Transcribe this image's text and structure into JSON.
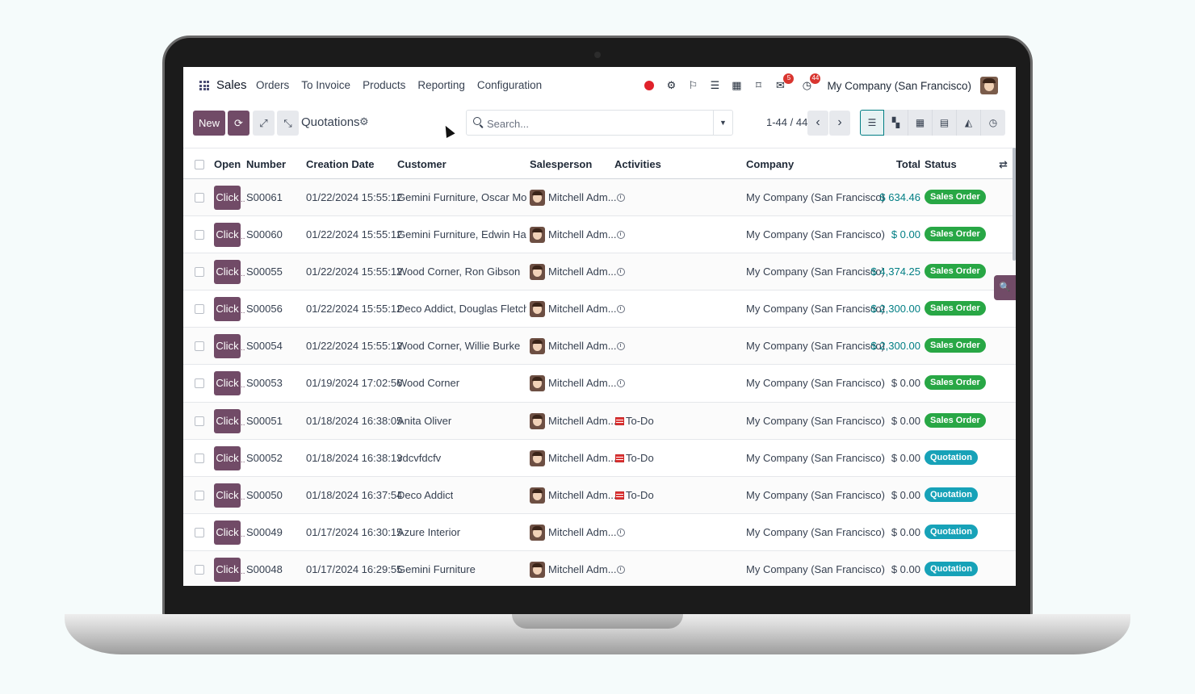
{
  "navbar": {
    "brand": "Sales",
    "menu": [
      "Orders",
      "To Invoice",
      "Products",
      "Reporting",
      "Configuration"
    ],
    "messages_badge": "5",
    "activities_badge": "44",
    "company": "My Company (San Francisco)"
  },
  "control_panel": {
    "new_label": "New",
    "title": "Quotations",
    "search_placeholder": "Search...",
    "pager": "1-44 / 44"
  },
  "table": {
    "headers": {
      "open": "Open",
      "number": "Number",
      "creation_date": "Creation Date",
      "customer": "Customer",
      "salesperson": "Salesperson",
      "activities": "Activities",
      "company": "Company",
      "total": "Total",
      "status": "Status"
    },
    "click_label": "Click",
    "rows": [
      {
        "number": "S00061",
        "date": "01/22/2024 15:55:12",
        "customer": "Gemini Furniture, Oscar Morg...",
        "salesperson": "Mitchell Adm...",
        "activity": "",
        "company": "My Company (San Francisco)",
        "total": "$ 634.46",
        "total_blue": true,
        "status": "Sales Order",
        "status_type": "so"
      },
      {
        "number": "S00060",
        "date": "01/22/2024 15:55:12",
        "customer": "Gemini Furniture, Edwin Hans...",
        "salesperson": "Mitchell Adm...",
        "activity": "",
        "company": "My Company (San Francisco)",
        "total": "$ 0.00",
        "total_blue": true,
        "status": "Sales Order",
        "status_type": "so"
      },
      {
        "number": "S00055",
        "date": "01/22/2024 15:55:12",
        "customer": "Wood Corner, Ron Gibson",
        "salesperson": "Mitchell Adm...",
        "activity": "",
        "company": "My Company (San Francisco)",
        "total": "$ 4,374.25",
        "total_blue": true,
        "status": "Sales Order",
        "status_type": "so"
      },
      {
        "number": "S00056",
        "date": "01/22/2024 15:55:12",
        "customer": "Deco Addict, Douglas Fletcher",
        "salesperson": "Mitchell Adm...",
        "activity": "",
        "company": "My Company (San Francisco)",
        "total": "$ 2,300.00",
        "total_blue": true,
        "status": "Sales Order",
        "status_type": "so"
      },
      {
        "number": "S00054",
        "date": "01/22/2024 15:55:12",
        "customer": "Wood Corner, Willie Burke",
        "salesperson": "Mitchell Adm...",
        "activity": "",
        "company": "My Company (San Francisco)",
        "total": "$ 2,300.00",
        "total_blue": true,
        "status": "Sales Order",
        "status_type": "so"
      },
      {
        "number": "S00053",
        "date": "01/19/2024 17:02:56",
        "customer": "Wood Corner",
        "salesperson": "Mitchell Adm...",
        "activity": "",
        "company": "My Company (San Francisco)",
        "total": "$ 0.00",
        "total_blue": false,
        "status": "Sales Order",
        "status_type": "so"
      },
      {
        "number": "S00051",
        "date": "01/18/2024 16:38:05",
        "customer": "Anita Oliver",
        "salesperson": "Mitchell Adm...",
        "activity": "To-Do",
        "company": "My Company (San Francisco)",
        "total": "$ 0.00",
        "total_blue": false,
        "status": "Sales Order",
        "status_type": "so"
      },
      {
        "number": "S00052",
        "date": "01/18/2024 16:38:13",
        "customer": "vdcvfdcfv",
        "salesperson": "Mitchell Adm...",
        "activity": "To-Do",
        "company": "My Company (San Francisco)",
        "total": "$ 0.00",
        "total_blue": false,
        "status": "Quotation",
        "status_type": "qt"
      },
      {
        "number": "S00050",
        "date": "01/18/2024 16:37:54",
        "customer": "Deco Addict",
        "salesperson": "Mitchell Adm...",
        "activity": "To-Do",
        "company": "My Company (San Francisco)",
        "total": "$ 0.00",
        "total_blue": false,
        "status": "Quotation",
        "status_type": "qt"
      },
      {
        "number": "S00049",
        "date": "01/17/2024 16:30:15",
        "customer": "Azure Interior",
        "salesperson": "Mitchell Adm...",
        "activity": "",
        "company": "My Company (San Francisco)",
        "total": "$ 0.00",
        "total_blue": false,
        "status": "Quotation",
        "status_type": "qt"
      },
      {
        "number": "S00048",
        "date": "01/17/2024 16:29:55",
        "customer": "Gemini Furniture",
        "salesperson": "Mitchell Adm...",
        "activity": "",
        "company": "My Company (San Francisco)",
        "total": "$ 0.00",
        "total_blue": false,
        "status": "Quotation",
        "status_type": "qt"
      }
    ]
  },
  "colors": {
    "primary": "#714b67",
    "teal": "#017e84",
    "sales_order": "#28a745",
    "quotation": "#17a2b8",
    "recording": "#e0222b"
  }
}
